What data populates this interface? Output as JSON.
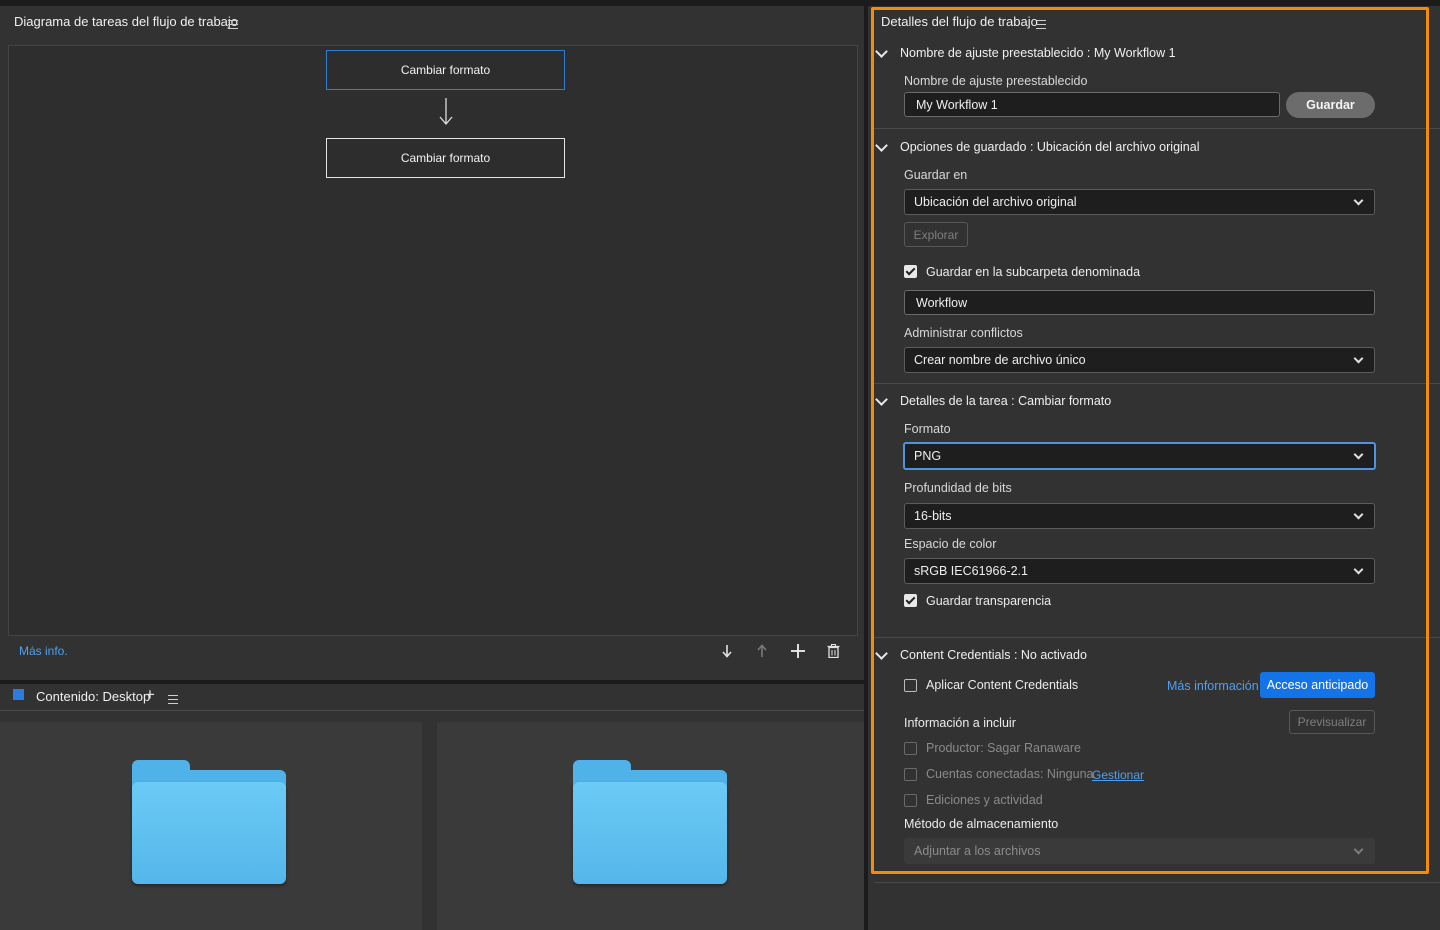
{
  "workflow_diagram": {
    "title": "Diagrama de tareas del flujo de trabajo",
    "nodes": [
      "Cambiar formato",
      "Cambiar formato"
    ],
    "more_info_link": "Más info."
  },
  "content_panel": {
    "title": "Contenido: Desktop",
    "tile_icons": [
      "folder-icon",
      "folder-icon"
    ]
  },
  "details": {
    "title": "Detalles del flujo de trabajo",
    "preset_section": {
      "header": "Nombre de ajuste preestablecido : My Workflow 1",
      "field_label": "Nombre de ajuste preestablecido",
      "field_value": "My Workflow 1",
      "save_button": "Guardar"
    },
    "save_section": {
      "header": "Opciones de guardado : Ubicación del archivo original",
      "save_in_label": "Guardar en",
      "save_in_value": "Ubicación del archivo original",
      "browse_button": "Explorar",
      "subfolder_checkbox": "Guardar en la subcarpeta denominada",
      "subfolder_value": "Workflow",
      "conflicts_label": "Administrar conflictos",
      "conflicts_value": "Crear nombre de archivo único"
    },
    "task_section": {
      "header": "Detalles de la tarea : Cambiar formato",
      "format_label": "Formato",
      "format_value": "PNG",
      "bit_depth_label": "Profundidad de bits",
      "bit_depth_value": "16-bits",
      "color_space_label": "Espacio de color",
      "color_space_value": "sRGB IEC61966-2.1",
      "transparency_checkbox": "Guardar transparencia"
    },
    "credentials_section": {
      "header": "Content Credentials : No activado",
      "apply_checkbox": "Aplicar Content Credentials",
      "more_info_link": "Más información",
      "early_access_button": "Acceso anticipado",
      "info_label": "Información a incluir",
      "preview_button": "Previsualizar",
      "producer": "Productor: Sagar Ranaware",
      "connected_accounts": "Cuentas conectadas: Ninguna",
      "manage_link": "Gestionar",
      "edits_activity": "Ediciones y actividad",
      "storage_label": "Método de almacenamiento",
      "storage_value": "Adjuntar a los archivos"
    }
  },
  "colors": {
    "panel_bg": "#323232",
    "highlight": "#f28c0f",
    "accent_blue": "#1473e6",
    "link_blue": "#4ea1f0"
  }
}
